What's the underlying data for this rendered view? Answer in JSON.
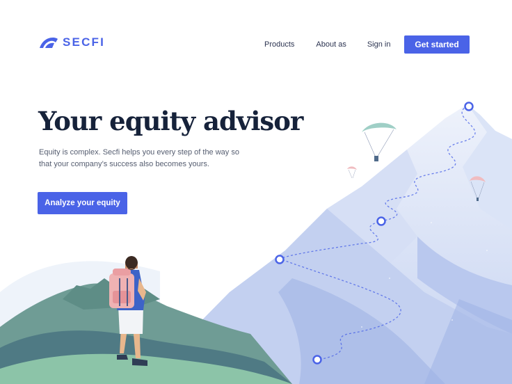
{
  "header": {
    "logo_text": "SECFI",
    "nav": {
      "products": "Products",
      "about": "About as",
      "signin": "Sign in"
    },
    "cta": "Get started"
  },
  "hero": {
    "title": "Your equity advisor",
    "description": "Equity is complex. Secfi helps you every step of the way so that your company’s success also becomes yours.",
    "cta": "Analyze your equity"
  },
  "colors": {
    "brand": "#4a63e7",
    "heading": "#16223a",
    "mountain_light": "#e3ebf8",
    "mountain_mid": "#b4c4ec",
    "hills_green": "#7fae9c"
  },
  "icons": [
    "logo-mark-icon",
    "waypoint-icon",
    "paraglider-icon",
    "hiker-figure",
    "mountain-illustration"
  ]
}
